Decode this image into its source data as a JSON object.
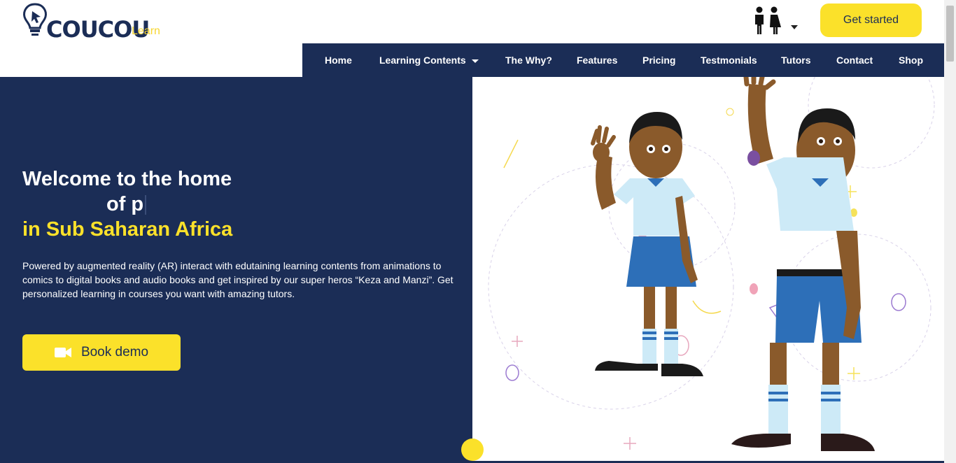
{
  "brand": {
    "name": "COUCOU",
    "suffix": "Learn",
    "primary_color": "#1b2d56",
    "accent_color": "#fbe12a"
  },
  "header": {
    "language_icon": "family-icon",
    "cta_label": "Get started"
  },
  "nav": {
    "items": [
      {
        "label": "Home"
      },
      {
        "label": "Learning Contents"
      },
      {
        "label": "The Why?"
      },
      {
        "label": "Features"
      },
      {
        "label": "Pricing"
      },
      {
        "label": "Testmonials"
      },
      {
        "label": "Tutors"
      },
      {
        "label": "Contact"
      },
      {
        "label": "Shop"
      }
    ]
  },
  "hero": {
    "title_line1": "Welcome to the home",
    "title_line2": "of p",
    "title_line3": "in Sub Saharan Africa",
    "description": "Powered by augmented reality (AR) interact with edutaining learning contents from animations to comics to digital books and audio books and get inspired by our super heros “Keza and Manzi”. Get personalized learning in courses you want with amazing tutors.",
    "demo_button_label": "Book demo",
    "demo_button_icon": "video-camera-icon"
  }
}
